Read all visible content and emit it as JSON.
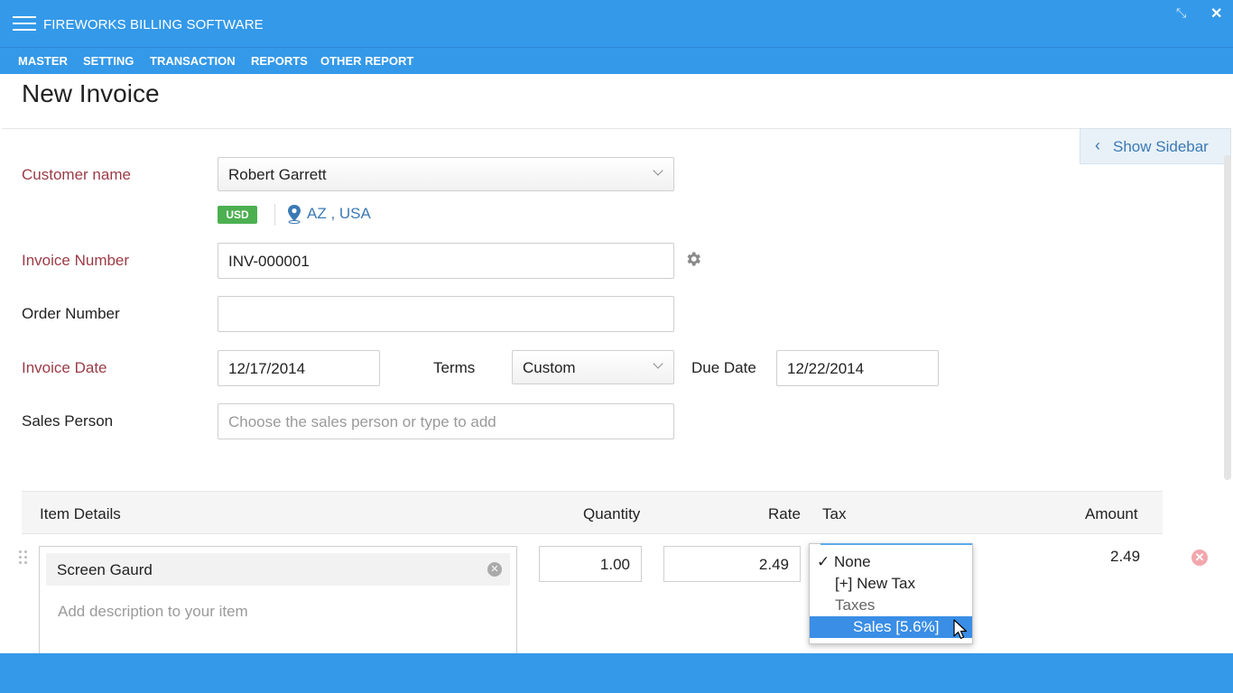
{
  "app": {
    "title": "FIREWORKS BILLING SOFTWARE",
    "restore_glyph": "⤡",
    "close_glyph": "✕"
  },
  "menu": {
    "items": [
      "MASTER",
      "SETTING",
      "TRANSACTION",
      "REPORTS",
      "OTHER REPORT"
    ]
  },
  "page": {
    "title": "New Invoice",
    "sidebar_label": "Show Sidebar"
  },
  "form": {
    "customer_label": "Customer name",
    "customer_value": "Robert Garrett",
    "currency_badge": "USD",
    "location": "AZ , USA",
    "invoice_number_label": "Invoice Number",
    "invoice_number_value": "INV-000001",
    "order_number_label": "Order Number",
    "order_number_value": "",
    "invoice_date_label": "Invoice Date",
    "invoice_date_value": "12/17/2014",
    "terms_label": "Terms",
    "terms_value": "Custom",
    "due_date_label": "Due Date",
    "due_date_value": "12/22/2014",
    "sales_person_label": "Sales Person",
    "sales_person_placeholder": "Choose the sales person or type to add"
  },
  "table": {
    "headers": {
      "item_details": "Item Details",
      "quantity": "Quantity",
      "rate": "Rate",
      "tax": "Tax",
      "amount": "Amount"
    },
    "rows": [
      {
        "item": "Screen Gaurd",
        "description_placeholder": "Add description to your item",
        "quantity": "1.00",
        "rate": "2.49",
        "amount": "2.49"
      }
    ]
  },
  "tax_dropdown": {
    "options": [
      {
        "label": "✓ None"
      },
      {
        "label": "[+] New Tax"
      },
      {
        "label": "Taxes"
      },
      {
        "label": "Sales [5.6%]"
      }
    ]
  },
  "colors": {
    "brand": "#3499e9",
    "required_label": "#9c3b46",
    "link": "#3b79b5",
    "usd_badge": "#4caf50",
    "selected_option": "#3a8ee6"
  }
}
